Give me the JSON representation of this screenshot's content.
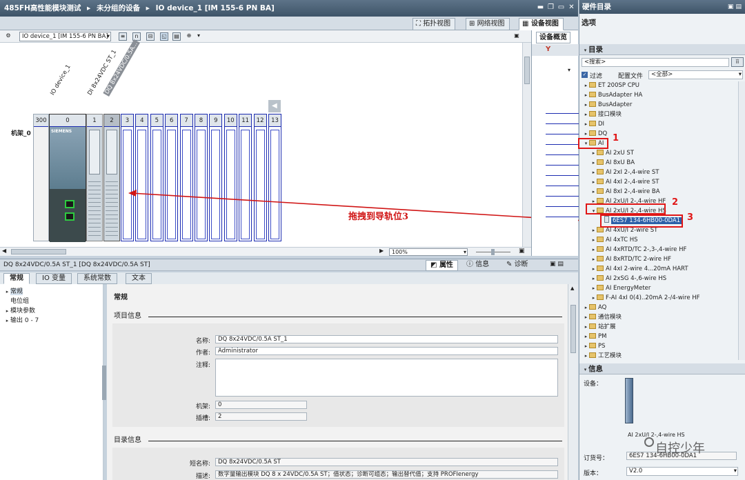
{
  "titlebar": {
    "breadcrumb": [
      "485FH高性能模块测试",
      "未分组的设备",
      "IO device_1 [IM 155-6 PN BA]"
    ],
    "sep": "▸"
  },
  "viewtabs": {
    "topology": "拓扑视图",
    "network": "网络视图",
    "device": "设备视图"
  },
  "toolbar": {
    "device_select": "IO device_1 [IM 155-6 PN BA]"
  },
  "rack": {
    "name": "机架_0",
    "slots": [
      "300",
      "0",
      "1",
      "2",
      "3",
      "4",
      "5",
      "6",
      "7",
      "8",
      "9",
      "10",
      "11",
      "12",
      "13"
    ],
    "device_labels": [
      "IO device_1",
      "DI 8x24VDC ST_1",
      "DQ 8x24VDC/0.5A..."
    ],
    "siemens": "SIEMENS"
  },
  "annotation": {
    "drag_text": "拖拽到导轨位3",
    "n1": "1",
    "n2": "2",
    "n3": "3"
  },
  "zoom": "100%",
  "overview_tab": "设备概览",
  "props": {
    "title": "DQ 8x24VDC/0.5A ST_1 [DQ 8x24VDC/0.5A ST]",
    "tabs": [
      "属性",
      "信息",
      "诊断"
    ],
    "subtabs": [
      "常规",
      "IO 变量",
      "系统常数",
      "文本"
    ],
    "nav": [
      "常规",
      "电位组",
      "模块参数",
      "输出 0 - 7"
    ],
    "section_general": "常规",
    "section_project": "项目信息",
    "labels": {
      "name": "名称:",
      "author": "作者:",
      "comment": "注释:",
      "rack": "机架:",
      "slot": "插槽:"
    },
    "values": {
      "name": "DQ 8x24VDC/0.5A ST_1",
      "author": "Administrator",
      "comment": "",
      "rack": "0",
      "slot": "2"
    },
    "section_catalog": "目录信息",
    "cat_labels": {
      "short": "短名称:",
      "desc": "描述:"
    },
    "cat_values": {
      "short": "DQ 8x24VDC/0.5A ST",
      "desc": "数字量输出模块 DQ 8 x 24VDC/0.5A ST；值状态；诊断可组态；输出替代值；支持 PROFIenergy"
    }
  },
  "catalog": {
    "header": "硬件目录",
    "options": "选项",
    "catalog_label": "目录",
    "search_placeholder": "<搜索>",
    "filter": "过滤",
    "profile_label": "配置文件",
    "profile_value": "<全部>",
    "items": [
      {
        "label": "ET 200SP CPU",
        "level": 0,
        "open": false,
        "kind": "folder"
      },
      {
        "label": "BusAdapter HA",
        "level": 0,
        "open": false,
        "kind": "folder"
      },
      {
        "label": "BusAdapter",
        "level": 0,
        "open": false,
        "kind": "folder"
      },
      {
        "label": "接口模块",
        "level": 0,
        "open": false,
        "kind": "folder"
      },
      {
        "label": "DI",
        "level": 0,
        "open": false,
        "kind": "folder"
      },
      {
        "label": "DQ",
        "level": 0,
        "open": false,
        "kind": "folder"
      },
      {
        "label": "AI",
        "level": 0,
        "open": true,
        "kind": "folder"
      },
      {
        "label": "AI 2xU ST",
        "level": 1,
        "open": false,
        "kind": "folder"
      },
      {
        "label": "AI 8xU BA",
        "level": 1,
        "open": false,
        "kind": "folder"
      },
      {
        "label": "AI 2xI 2-,4-wire ST",
        "level": 1,
        "open": false,
        "kind": "folder"
      },
      {
        "label": "AI 4xI 2-,4-wire ST",
        "level": 1,
        "open": false,
        "kind": "folder"
      },
      {
        "label": "AI 8xI 2-,4-wire BA",
        "level": 1,
        "open": false,
        "kind": "folder"
      },
      {
        "label": "AI 2xU/I 2-,4-wire HF",
        "level": 1,
        "open": false,
        "kind": "folder"
      },
      {
        "label": "AI 2xU/I 2-,4-wire HS",
        "level": 1,
        "open": true,
        "kind": "folder"
      },
      {
        "label": "6ES7 134-6HB00-0DA1",
        "level": 2,
        "open": false,
        "kind": "module",
        "selected": true
      },
      {
        "label": "AI 4xU/I 2-wire ST",
        "level": 1,
        "open": false,
        "kind": "folder"
      },
      {
        "label": "AI 4xTC HS",
        "level": 1,
        "open": false,
        "kind": "folder"
      },
      {
        "label": "AI 4xRTD/TC 2-,3-,4-wire HF",
        "level": 1,
        "open": false,
        "kind": "folder"
      },
      {
        "label": "AI 8xRTD/TC 2-wire HF",
        "level": 1,
        "open": false,
        "kind": "folder"
      },
      {
        "label": "AI 4xI 2-wire 4...20mA HART",
        "level": 1,
        "open": false,
        "kind": "folder"
      },
      {
        "label": "AI 2xSG 4-,6-wire HS",
        "level": 1,
        "open": false,
        "kind": "folder"
      },
      {
        "label": "AI EnergyMeter",
        "level": 1,
        "open": false,
        "kind": "folder"
      },
      {
        "label": "F-AI 4xI 0(4)..20mA 2-/4-wire HF",
        "level": 1,
        "open": false,
        "kind": "folder"
      },
      {
        "label": "AQ",
        "level": 0,
        "open": false,
        "kind": "folder"
      },
      {
        "label": "通信模块",
        "level": 0,
        "open": false,
        "kind": "folder"
      },
      {
        "label": "站扩展",
        "level": 0,
        "open": false,
        "kind": "folder"
      },
      {
        "label": "PM",
        "level": 0,
        "open": false,
        "kind": "folder"
      },
      {
        "label": "PS",
        "level": 0,
        "open": false,
        "kind": "folder"
      },
      {
        "label": "工艺模块",
        "level": 0,
        "open": false,
        "kind": "folder"
      }
    ],
    "info_header": "信息",
    "device_label": "设备：",
    "device_name": "AI 2xU/I 2-,4-wire HS",
    "order_label": "订货号：",
    "order_value": "6ES7 134-6HB00-0DA1",
    "version_label": "版本：",
    "version_value": "V2.0",
    "watermark": "自控少年"
  }
}
